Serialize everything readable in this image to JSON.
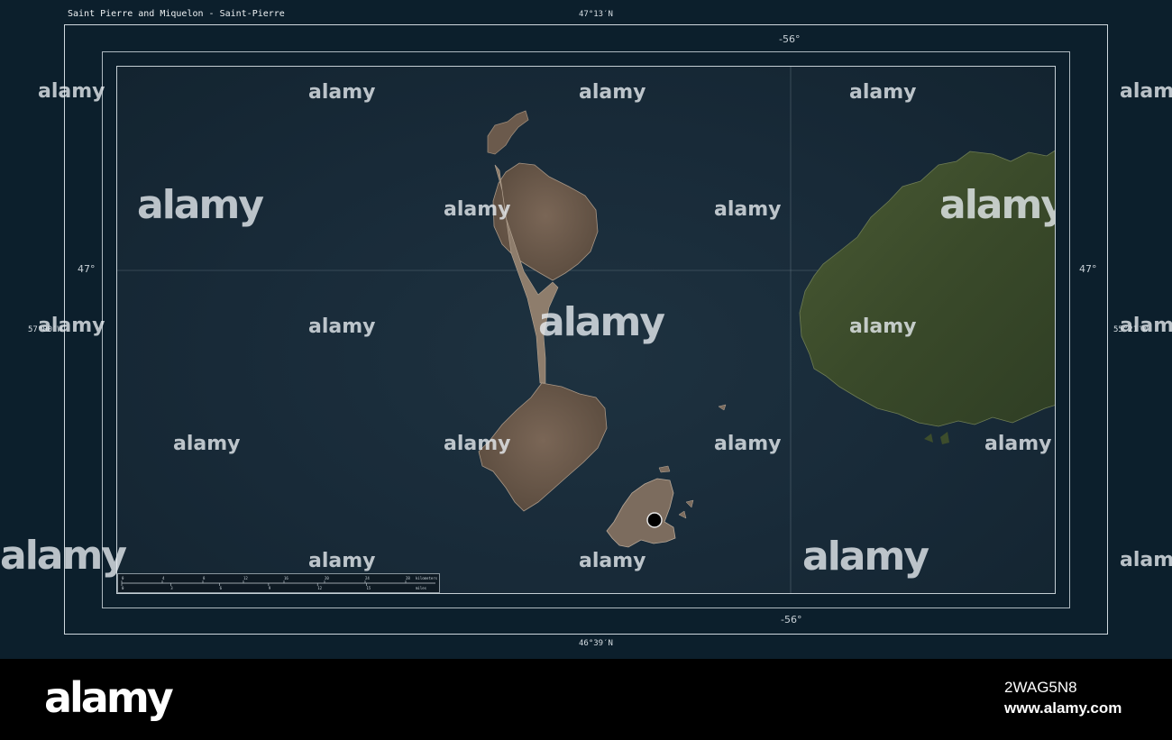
{
  "map": {
    "title": "Saint Pierre and Miquelon - Saint-Pierre",
    "lat_top": "47°13′N",
    "lat_bottom": "46°39′N",
    "lon_left": "57°00′W",
    "lon_right": "55°21′W",
    "grid_lon": "-56°",
    "grid_lat": "47°",
    "marker": "Saint-Pierre",
    "scale_bar": {
      "km_ticks": [
        "0",
        "4",
        "8",
        "12",
        "16",
        "20",
        "24",
        "28"
      ],
      "km_unit": "kilometers",
      "mi_ticks": [
        "0",
        "3",
        "6",
        "9",
        "12",
        "15"
      ],
      "mi_unit": "miles"
    },
    "colors": {
      "sea": "#182a38",
      "land_islands": "#6b5a4c",
      "land_newfoundland": "#3d4d2c",
      "frame": "#cfd8de"
    }
  },
  "watermark": "alamy",
  "footer": {
    "logo": "alamy",
    "image_id": "2WAG5N8",
    "url": "www.alamy.com"
  }
}
